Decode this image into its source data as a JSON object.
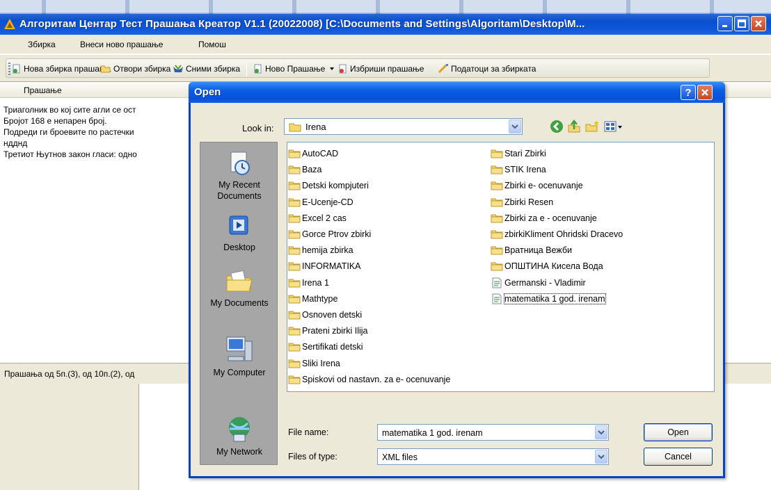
{
  "app": {
    "title": "Алгоритам Центар Тест Прашања Креатор V1.1 (20022008) [C:\\Documents and Settings\\Algoritam\\Desktop\\M...",
    "menu": [
      "Збирка",
      "Внеси ново прашање",
      "Помош"
    ],
    "toolbar": {
      "new_collection": "Нова збирка прашања",
      "open_collection": "Отвори збирка",
      "save_collection": "Сними збирка",
      "new_question": "Ново Прашање",
      "delete_question": "Избриши прашање",
      "collection_info": "Податоци за збирката"
    },
    "column_header": "Прашање",
    "questions": [
      "Триаголник во кој сите агли се ост",
      "Бројот 168 е непарен број.",
      "Подреди ги броевите по растечки",
      "ндднд",
      "Третиот Њутнов закон гласи: одно"
    ],
    "status": "Прашања од 5п.(3), од 10п.(2), од"
  },
  "dialog": {
    "title": "Open",
    "help_label": "?",
    "look_in_label": "Look in:",
    "look_in_value": "Irena",
    "places": [
      "My Recent Documents",
      "Desktop",
      "My Documents",
      "My Computer",
      "My Network"
    ],
    "folders_col1": [
      "AutoCAD",
      "Baza",
      "Detski kompjuteri",
      "E-Ucenje-CD",
      "Excel 2 cas",
      "Gorce Ptrov zbirki",
      "hemija zbirka",
      "INFORMATIKA",
      "Irena 1",
      "Mathtype",
      "Osnoven detski",
      "Prateni zbirki Ilija",
      "Sertifikati detski",
      "Sliki Irena",
      "Spiskovi od nastavn. za e- ocenuvanje"
    ],
    "folders_col2": [
      "Stari  Zbirki",
      "STIK Irena",
      "Zbirki e- ocenuvanje",
      "Zbirki Resen",
      "Zbirki za e - ocenuvanje",
      "zbirkiKliment Ohridski Dracevo",
      "Вратница Вежби",
      "ОПШТИНА Кисела Вода"
    ],
    "files_col2": [
      "Germanski - Vladimir",
      "matematika 1 god. irenam"
    ],
    "file_name_label": "File name:",
    "file_name_value": "matematika 1 god. irenam",
    "file_type_label": "Files of type:",
    "file_type_value": "XML files",
    "open_button": "Open",
    "cancel_button": "Cancel"
  },
  "colors": {
    "title_blue": "#0a4fcf",
    "face": "#ece9d8",
    "close_red": "#c64a23"
  }
}
